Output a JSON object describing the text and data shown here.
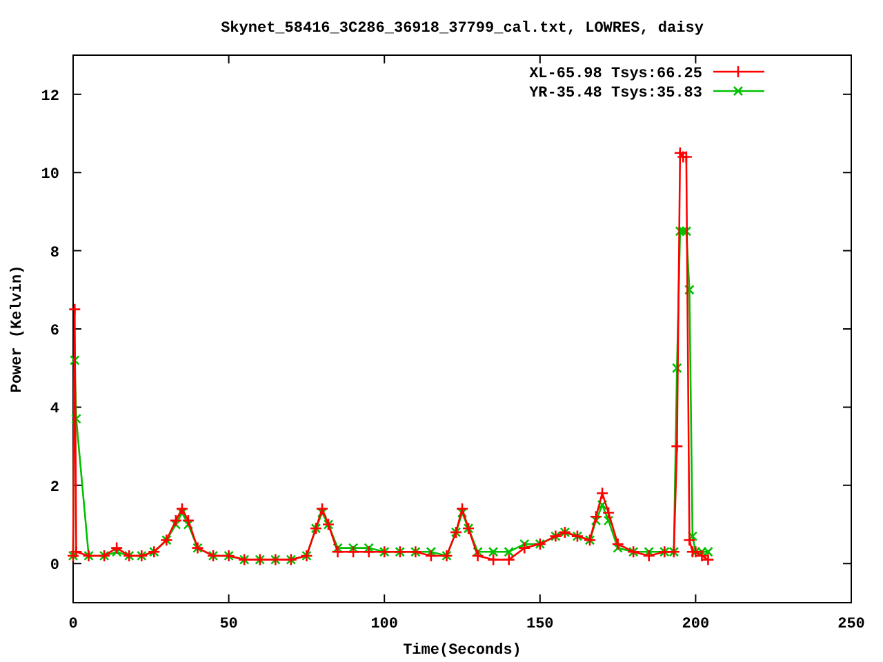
{
  "chart": {
    "chart_data": {
      "type": "line",
      "title": "Skynet_58416_3C286_36918_37799_cal.txt, LOWRES, daisy",
      "xlabel": "Time(Seconds)",
      "ylabel": "Power (Kelvin)",
      "x": [
        0,
        0.5,
        1,
        5,
        10,
        14,
        18,
        22,
        26,
        30,
        33,
        35,
        37,
        40,
        45,
        50,
        55,
        60,
        65,
        70,
        75,
        78,
        80,
        82,
        85,
        90,
        95,
        100,
        105,
        110,
        115,
        120,
        123,
        125,
        127,
        130,
        135,
        140,
        145,
        150,
        155,
        158,
        162,
        166,
        168,
        170,
        172,
        175,
        180,
        185,
        190,
        193,
        194,
        195,
        196,
        197,
        198,
        199,
        200,
        202,
        204
      ],
      "series": [
        {
          "name": "XL-65.98 Tsys:66.25",
          "color": "#ff0000",
          "marker": "plus",
          "values": [
            0.2,
            6.5,
            0.3,
            0.2,
            0.2,
            0.4,
            0.2,
            0.2,
            0.3,
            0.6,
            1.1,
            1.4,
            1.1,
            0.4,
            0.2,
            0.2,
            0.1,
            0.1,
            0.1,
            0.1,
            0.2,
            0.9,
            1.4,
            1.0,
            0.3,
            0.3,
            0.3,
            0.3,
            0.3,
            0.3,
            0.2,
            0.2,
            0.8,
            1.4,
            0.9,
            0.2,
            0.1,
            0.1,
            0.4,
            0.5,
            0.7,
            0.8,
            0.7,
            0.6,
            1.2,
            1.8,
            1.3,
            0.5,
            0.3,
            0.2,
            0.3,
            0.3,
            3.0,
            10.5,
            10.4,
            10.4,
            0.6,
            0.3,
            0.3,
            0.2,
            0.1
          ]
        },
        {
          "name": "YR-35.48 Tsys:35.83",
          "color": "#00c000",
          "marker": "cross",
          "values": [
            0.2,
            5.2,
            3.7,
            0.2,
            0.2,
            0.3,
            0.2,
            0.2,
            0.3,
            0.6,
            1.0,
            1.3,
            1.0,
            0.4,
            0.2,
            0.2,
            0.1,
            0.1,
            0.1,
            0.1,
            0.2,
            0.9,
            1.3,
            1.0,
            0.4,
            0.4,
            0.4,
            0.3,
            0.3,
            0.3,
            0.3,
            0.2,
            0.8,
            1.3,
            0.9,
            0.3,
            0.3,
            0.3,
            0.5,
            0.5,
            0.7,
            0.8,
            0.7,
            0.6,
            1.1,
            1.5,
            1.1,
            0.4,
            0.3,
            0.3,
            0.3,
            0.3,
            5.0,
            8.5,
            8.5,
            8.5,
            7.0,
            0.7,
            0.3,
            0.3,
            0.3
          ]
        }
      ],
      "legend": true,
      "xlim": [
        0,
        250
      ],
      "ylim": [
        -1,
        13
      ],
      "xticks": [
        0,
        50,
        100,
        150,
        200,
        250
      ],
      "yticks": [
        0,
        2,
        4,
        6,
        8,
        10,
        12
      ]
    }
  }
}
